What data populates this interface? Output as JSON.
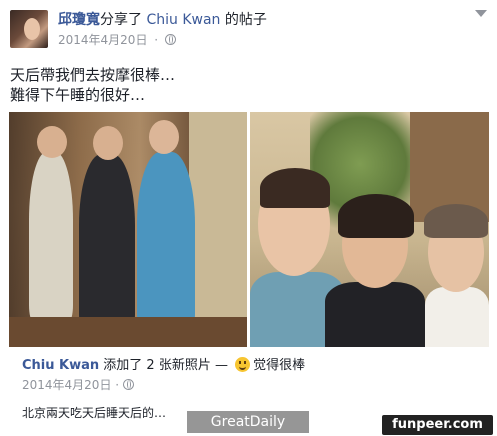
{
  "post": {
    "author": "邱瓊寬",
    "action": "分享了",
    "shared_from": "Chiu Kwan",
    "shared_suffix": "的帖子",
    "date": "2014年4月20日",
    "separator": "·",
    "privacy_icon": "globe-icon",
    "menu_icon": "chevron-down-icon",
    "text_lines": [
      "天后帶我們去按摩很棒…",
      "難得下午睡的很好…"
    ]
  },
  "photos": {
    "count": 2
  },
  "shared_post": {
    "author": "Chiu Kwan",
    "action": "添加了 2 张新照片 —",
    "feeling_icon": "smiley-icon",
    "feeling": "觉得很棒",
    "date": "2014年4月20日",
    "separator": "·",
    "text": "北京兩天吃天后睡天后的…"
  },
  "watermarks": {
    "greatdaily": "GreatDaily",
    "funpeer": "funpeer.com"
  }
}
